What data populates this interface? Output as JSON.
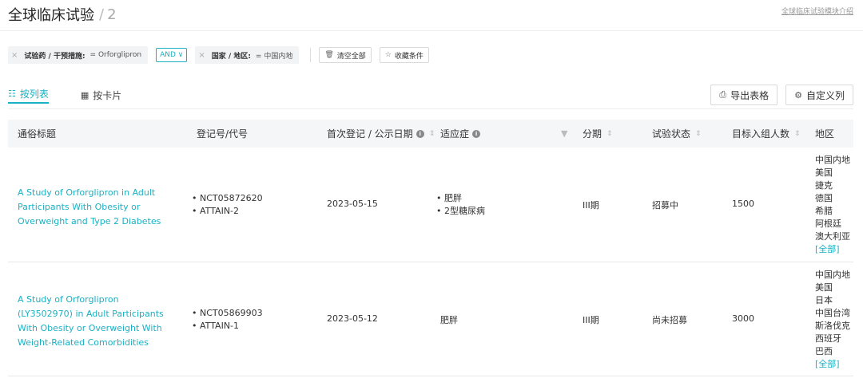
{
  "header": {
    "title": "全球临床试验",
    "sep": "/",
    "count": "2",
    "intro_link": "全球临床试验模块介绍"
  },
  "filters": {
    "chip1": {
      "close": "×",
      "key": "试验药 / 干预措施:",
      "value": "= Orforglipron"
    },
    "logic": "AND ∨",
    "chip2": {
      "close": "×",
      "key": "国家 / 地区:",
      "value": "= 中国内地"
    },
    "clear_all": "清空全部",
    "save_condition": "收藏条件"
  },
  "tabs": [
    {
      "label": "按列表",
      "active": true
    },
    {
      "label": "按卡片",
      "active": false
    }
  ],
  "actions": {
    "export": "导出表格",
    "customize": "自定义列"
  },
  "table": {
    "columns": {
      "title": "通俗标题",
      "reg": "登记号/代号",
      "date": "首次登记 / 公示日期",
      "indication": "适应症",
      "phase": "分期",
      "status": "试验状态",
      "target": "目标入组人数",
      "region": "地区"
    },
    "rows": [
      {
        "title": "A Study of Orforglipron in Adult Participants With Obesity or Overweight and Type 2 Diabetes",
        "reg": [
          "NCT05872620",
          "ATTAIN-2"
        ],
        "date": "2023-05-15",
        "indication": [
          "肥胖",
          "2型糖尿病"
        ],
        "phase": "III期",
        "status": "招募中",
        "target": "1500",
        "regions": [
          "中国内地",
          "美国",
          "捷克",
          "德国",
          "希腊",
          "阿根廷",
          "澳大利亚"
        ],
        "all": "[全部]"
      },
      {
        "title": "A Study of Orforglipron (LY3502970) in Adult Participants With Obesity or Overweight With Weight-Related Comorbidities",
        "reg": [
          "NCT05869903",
          "ATTAIN-1"
        ],
        "date": "2023-05-12",
        "indication": [
          "肥胖"
        ],
        "phase": "III期",
        "status": "尚未招募",
        "target": "3000",
        "regions": [
          "中国内地",
          "美国",
          "日本",
          "中国台湾",
          "斯洛伐克",
          "西班牙",
          "巴西"
        ],
        "all": "[全部]"
      }
    ]
  }
}
